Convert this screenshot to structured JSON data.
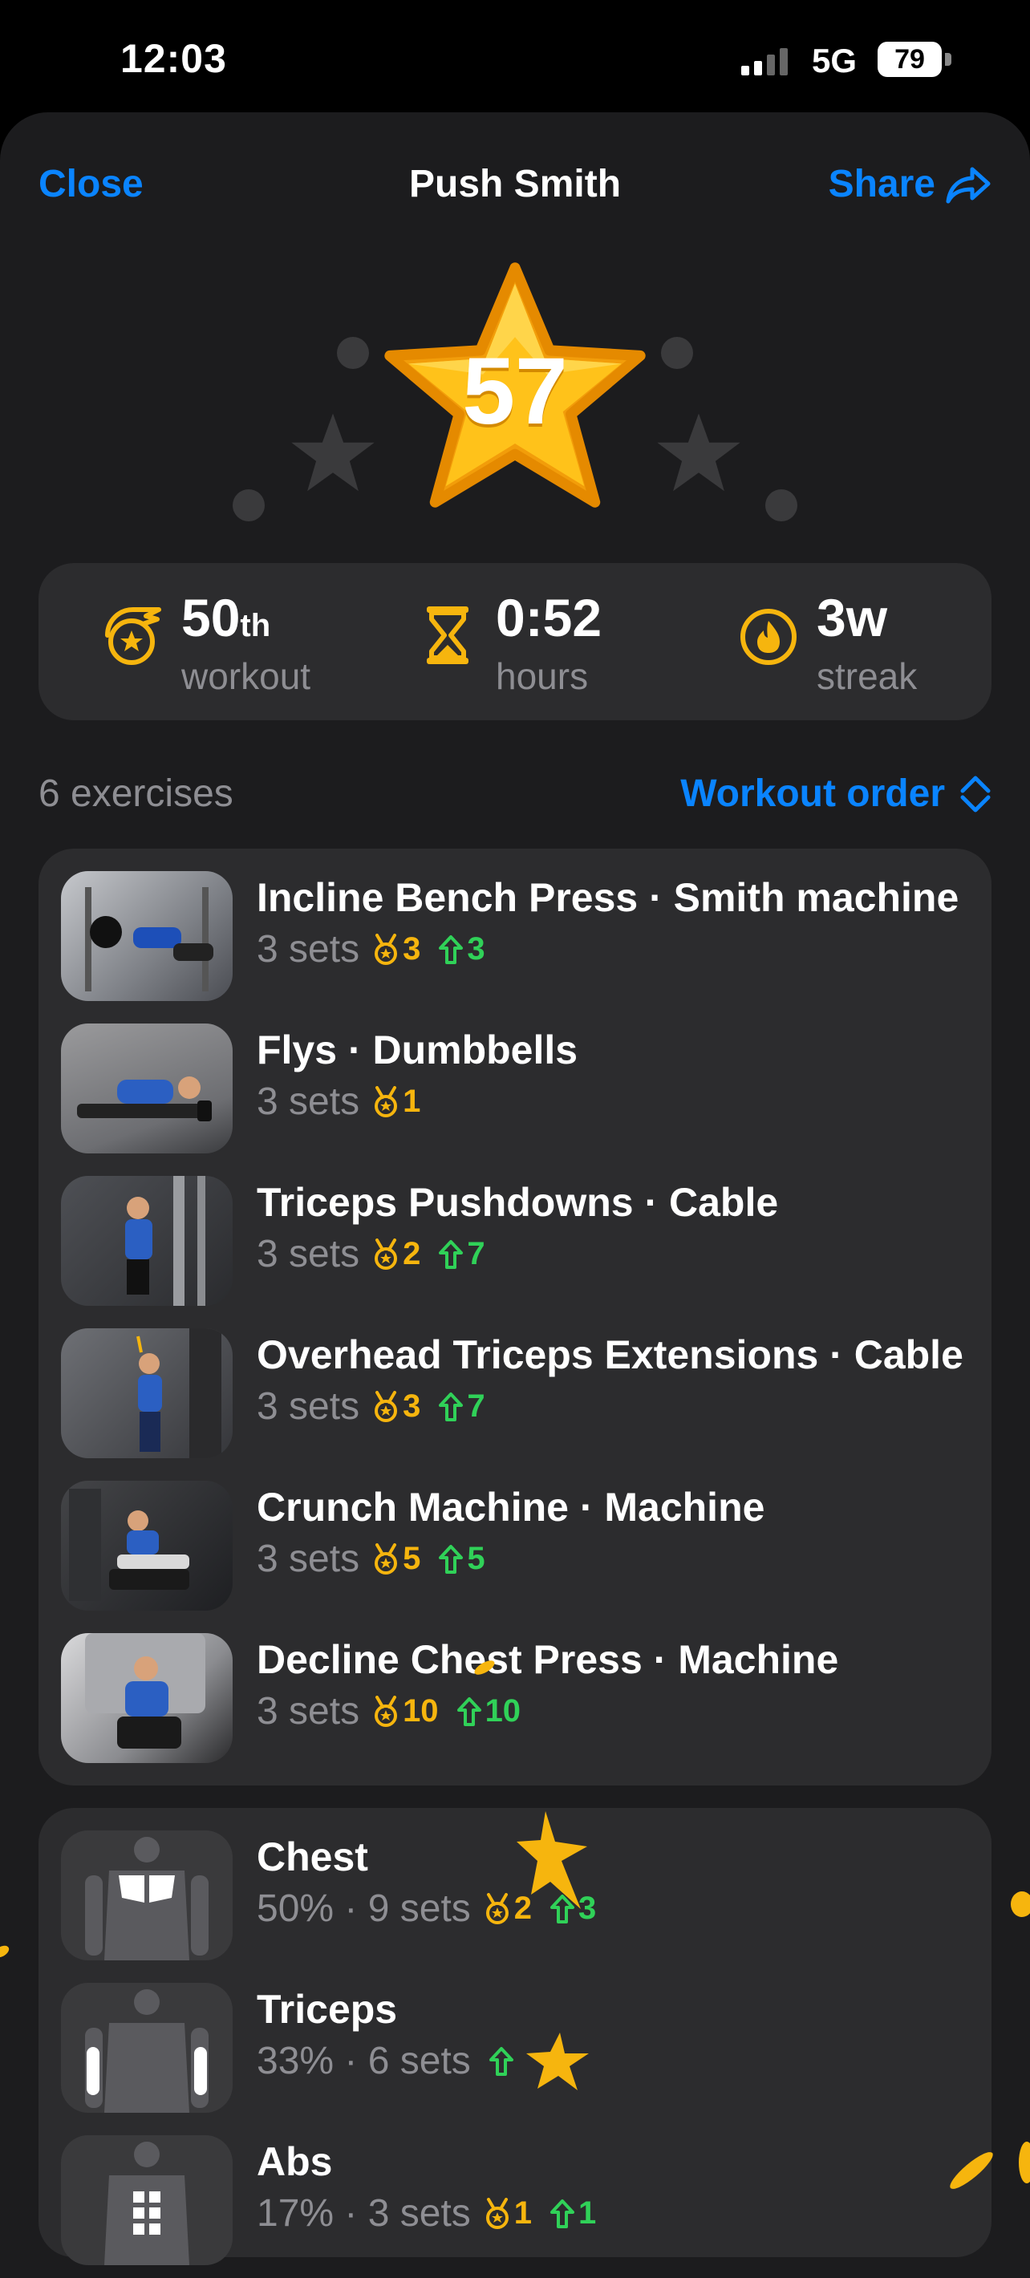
{
  "status": {
    "time": "12:03",
    "network": "5G",
    "battery": "79"
  },
  "nav": {
    "close": "Close",
    "title": "Push Smith",
    "share": "Share"
  },
  "hero": {
    "score": "57"
  },
  "stats": [
    {
      "icon": "shooting-star-icon",
      "value": "50",
      "suffix": "th",
      "label": "workout"
    },
    {
      "icon": "hourglass-icon",
      "value": "0:52",
      "suffix": "",
      "label": "hours"
    },
    {
      "icon": "flame-icon",
      "value": "3w",
      "suffix": "",
      "label": "streak"
    }
  ],
  "exercises_header": {
    "count": "6 exercises",
    "order": "Workout order"
  },
  "exercises": [
    {
      "name": "Incline Bench Press · Smith machine",
      "sets": "3 sets",
      "pr": "3",
      "up": "3"
    },
    {
      "name": "Flys · Dumbbells",
      "sets": "3 sets",
      "pr": "1",
      "up": ""
    },
    {
      "name": "Triceps Pushdowns · Cable",
      "sets": "3 sets",
      "pr": "2",
      "up": "7"
    },
    {
      "name": "Overhead Triceps Extensions · Cable",
      "sets": "3 sets",
      "pr": "3",
      "up": "7"
    },
    {
      "name": "Crunch Machine · Machine",
      "sets": "3 sets",
      "pr": "5",
      "up": "5"
    },
    {
      "name": "Decline Chest Press · Machine",
      "sets": "3 sets",
      "pr": "10",
      "up": "10"
    }
  ],
  "muscles": [
    {
      "name": "Chest",
      "meta": "50% · 9 sets",
      "pr": "2",
      "up": "3"
    },
    {
      "name": "Triceps",
      "meta": "33% · 6 sets",
      "pr": "",
      "up": ""
    },
    {
      "name": "Abs",
      "meta": "17% · 3 sets",
      "pr": "1",
      "up": "1"
    }
  ],
  "colors": {
    "accent": "#0a84ff",
    "gold": "#f6b50e",
    "green": "#30d158",
    "card": "#2c2c2e",
    "sheet": "#1c1c1e"
  }
}
